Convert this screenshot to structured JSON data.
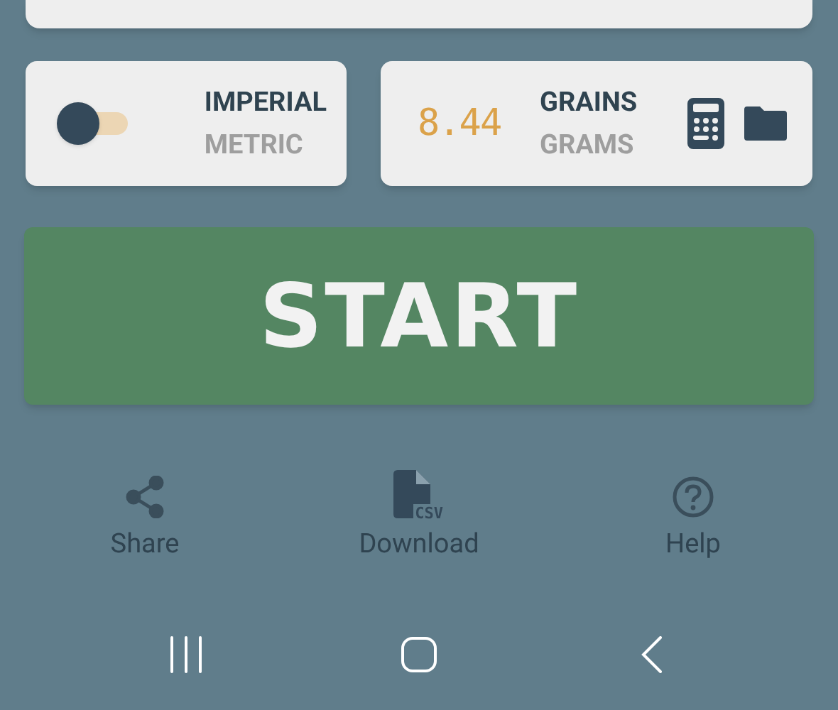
{
  "unit_system": {
    "toggle_on": false,
    "options": [
      {
        "label": "IMPERIAL",
        "selected": true
      },
      {
        "label": "METRIC",
        "selected": false
      }
    ]
  },
  "weight": {
    "reading": "8.44",
    "units": [
      {
        "label": "GRAINS",
        "selected": true
      },
      {
        "label": "GRAMS",
        "selected": false
      }
    ]
  },
  "start_button": {
    "label": "START"
  },
  "actions": [
    {
      "kind": "share",
      "label": "Share"
    },
    {
      "kind": "csv",
      "label": "Download",
      "icon_text": "CSV"
    },
    {
      "kind": "help",
      "label": "Help"
    }
  ],
  "nav_bar": [
    {
      "kind": "recents"
    },
    {
      "kind": "home"
    },
    {
      "kind": "back"
    }
  ]
}
